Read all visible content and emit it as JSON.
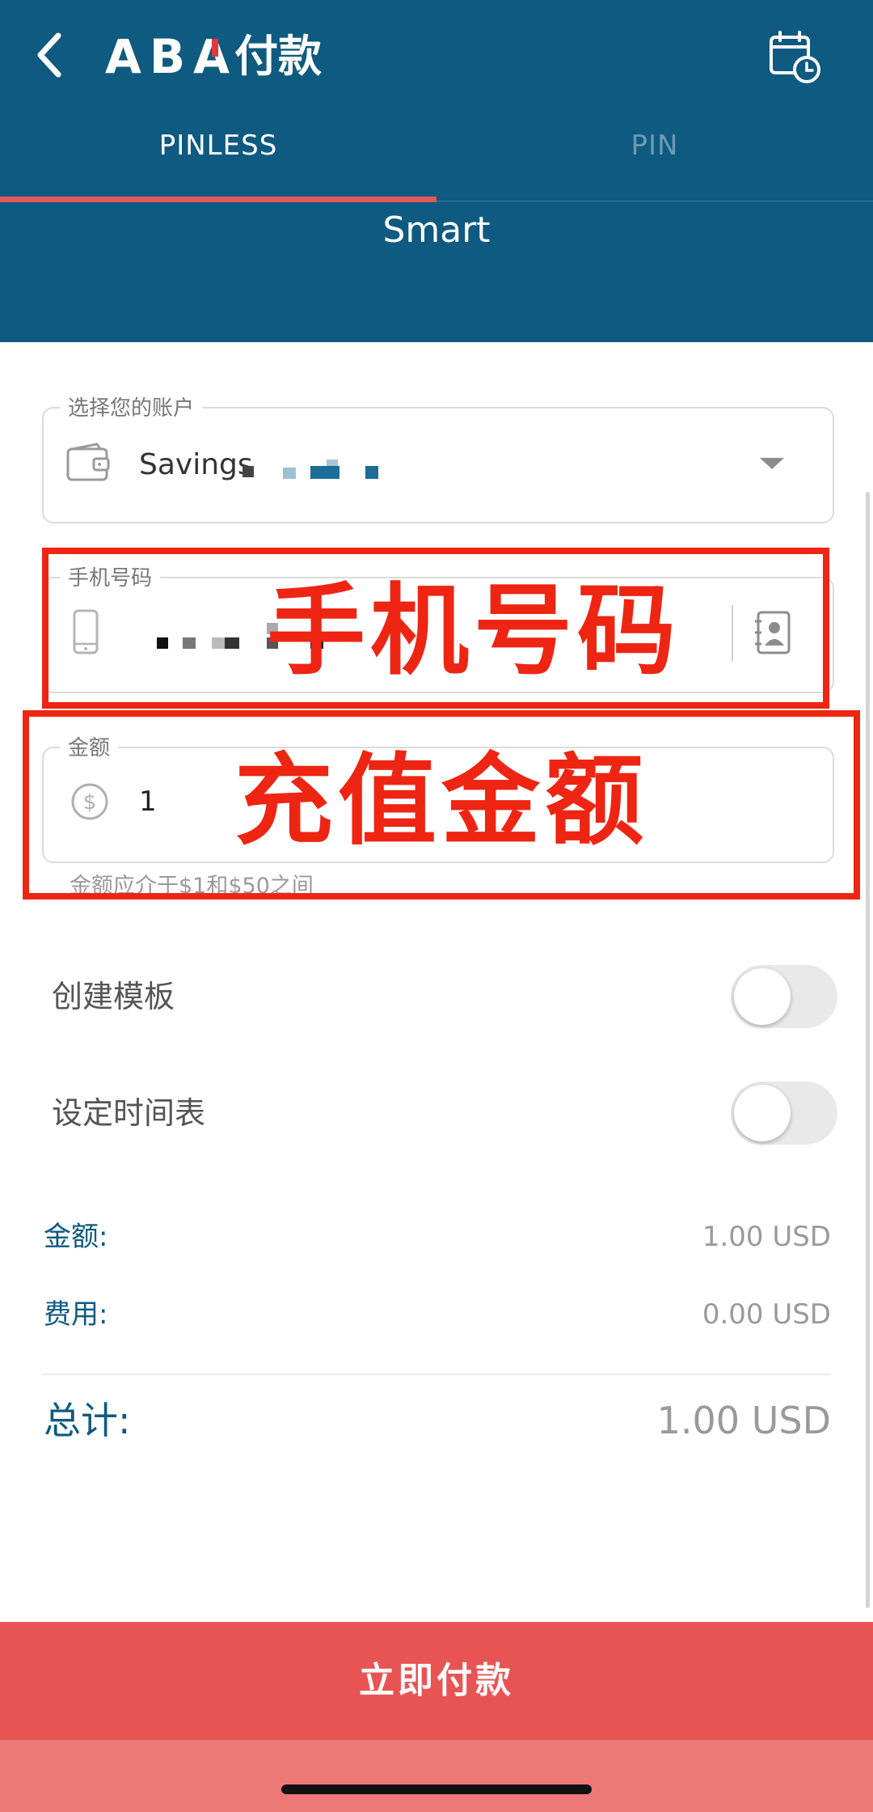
{
  "header": {
    "logo": "ABA",
    "title": "付款",
    "tabs": [
      {
        "label": "PINLESS",
        "active": true
      },
      {
        "label": "PIN",
        "active": false
      }
    ],
    "operator": "Smart"
  },
  "form": {
    "account": {
      "label": "选择您的账户",
      "value": "Savings"
    },
    "phone": {
      "label": "手机号码"
    },
    "amount": {
      "label": "金额",
      "value": "1",
      "hint": "金额应介于$1和$50之间"
    }
  },
  "annotations": {
    "phone": "手机号码",
    "amount": "充值金额"
  },
  "toggles": {
    "create_template": {
      "label": "创建模板",
      "on": false
    },
    "set_schedule": {
      "label": "设定时间表",
      "on": false
    }
  },
  "summary": {
    "amount_label": "金额:",
    "amount_value": "1.00 USD",
    "fee_label": "费用:",
    "fee_value": "0.00 USD",
    "total_label": "总计:",
    "total_value": "1.00 USD"
  },
  "pay_button": "立即付款",
  "colors": {
    "header": "#0f5a80",
    "accent": "#e85454",
    "annotation": "#ee2512"
  },
  "icons": [
    "back-icon",
    "calendar-clock-icon",
    "wallet-icon",
    "phone-icon",
    "contact-book-icon",
    "dollar-icon",
    "dropdown-arrow-icon"
  ]
}
